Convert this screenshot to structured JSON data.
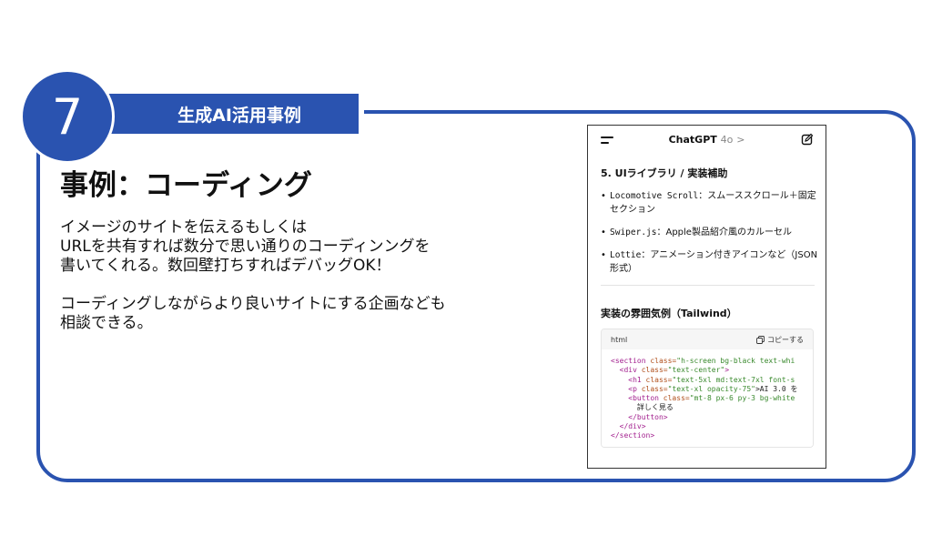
{
  "section": {
    "number": "7",
    "label": "生成AI活用事例"
  },
  "heading": "事例：コーディング",
  "body": {
    "lines": [
      "イメージのサイトを伝えるもしくは",
      "URLを共有すれば数分で思い通りのコーディンングを",
      "書いてくれる。数回壁打ちすればデバッグOK！"
    ],
    "lines2": [
      "コーディングしながらより良いサイトにする企画なども",
      "相談できる。"
    ]
  },
  "phone": {
    "app_title": "ChatGPT",
    "model": "4o",
    "chevron": ">",
    "section_title": "5. UIライブラリ / 実装補助",
    "libraries": [
      {
        "name": "Locomotive Scroll",
        "desc": "：スムーススクロール＋固定セクション"
      },
      {
        "name": "Swiper.js",
        "desc": "：Apple製品紹介風のカルーセル"
      },
      {
        "name": "Lottie",
        "desc": "：アニメーション付きアイコンなど（JSON形式）"
      }
    ],
    "bullet": "•",
    "example_title": "実装の雰囲気例（Tailwind）",
    "code": {
      "lang": "html",
      "copy_label": "コピーする",
      "button_text": "詳しく見る",
      "lines": {
        "l1_tag": "<section",
        "l1_attr": " class=",
        "l1_str": "\"h-screen bg-black text-whi",
        "l2_tag": "  <div",
        "l2_attr": " class=",
        "l2_str": "\"text-center\"",
        "l2_end": ">",
        "l3_tag": "    <h1",
        "l3_attr": " class=",
        "l3_str": "\"text-5xl md:text-7xl font-s",
        "l4_tag": "    <p",
        "l4_attr": " class=",
        "l4_str": "\"text-xl opacity-75\"",
        "l4_end": ">AI 3.0 を",
        "l5_tag": "    <button",
        "l5_attr": " class=",
        "l5_str": "\"mt-8 px-6 py-3 bg-white",
        "l7_tag": "    </button>",
        "l8_tag": "  </div>",
        "l9_tag": "</section>"
      }
    }
  },
  "colors": {
    "accent": "#2a53b0"
  }
}
